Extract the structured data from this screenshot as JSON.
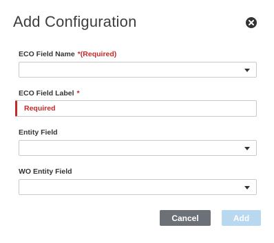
{
  "dialog": {
    "title": "Add Configuration",
    "close_icon": "close-circle-icon"
  },
  "fields": {
    "eco_field_name": {
      "label": "ECO Field Name",
      "required_star": "*",
      "required_text": "(Required)",
      "value": ""
    },
    "eco_field_label": {
      "label": "ECO Field Label",
      "required_star": "*",
      "placeholder": "Required",
      "value": ""
    },
    "entity_field": {
      "label": "Entity Field",
      "value": ""
    },
    "wo_entity_field": {
      "label": "WO Entity Field",
      "value": ""
    }
  },
  "buttons": {
    "cancel_label": "Cancel",
    "add_label": "Add"
  },
  "colors": {
    "required_red": "#c62828",
    "cancel_gray": "#6c7177",
    "add_disabled_blue": "#b8d8f0"
  },
  "icons": {
    "dropdown": "chevron-down-icon"
  }
}
